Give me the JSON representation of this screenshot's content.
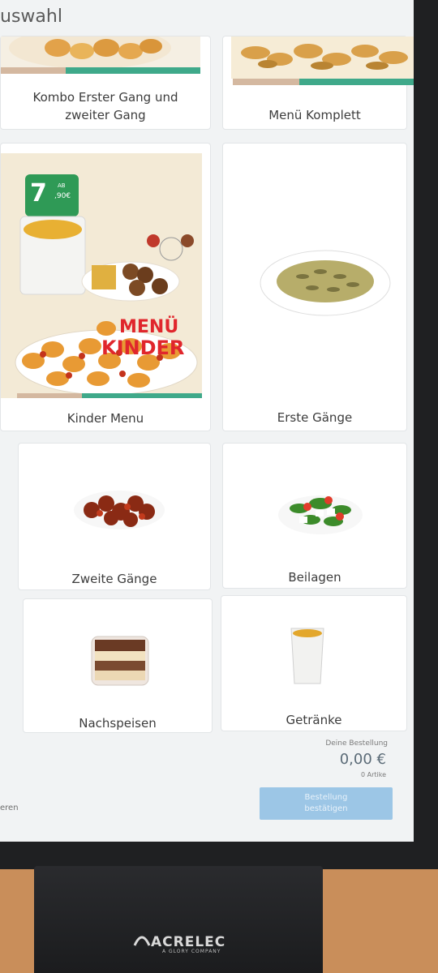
{
  "header": {
    "title": "uswahl"
  },
  "categories": [
    {
      "label": "Kombo Erster Gang und\nzweiter Gang"
    },
    {
      "label": "Menü Komplett"
    },
    {
      "label": "Kinder Menu"
    },
    {
      "label": "Erste Gänge"
    },
    {
      "label": "Zweite Gänge"
    },
    {
      "label": "Beilagen"
    },
    {
      "label": "Nachspeisen"
    },
    {
      "label": "Getränke"
    }
  ],
  "promo": {
    "title_line1": "MENÜ",
    "title_line2": "KINDER",
    "price_prefix": "AB",
    "price_main": "7",
    "price_cents": ",90€"
  },
  "order": {
    "label": "Deine Bestellung",
    "total": "0,00 €",
    "count": "0 Artike"
  },
  "buttons": {
    "confirm": "Bestellung\nbestätigen",
    "cancel": "eren"
  },
  "kiosk": {
    "brand": "ACRELEC",
    "brand_sub": "A GLORY COMPANY"
  },
  "colors": {
    "accent": "#9cc6e6",
    "promo_red": "#e0262c",
    "promo_green": "#2f9a56"
  }
}
